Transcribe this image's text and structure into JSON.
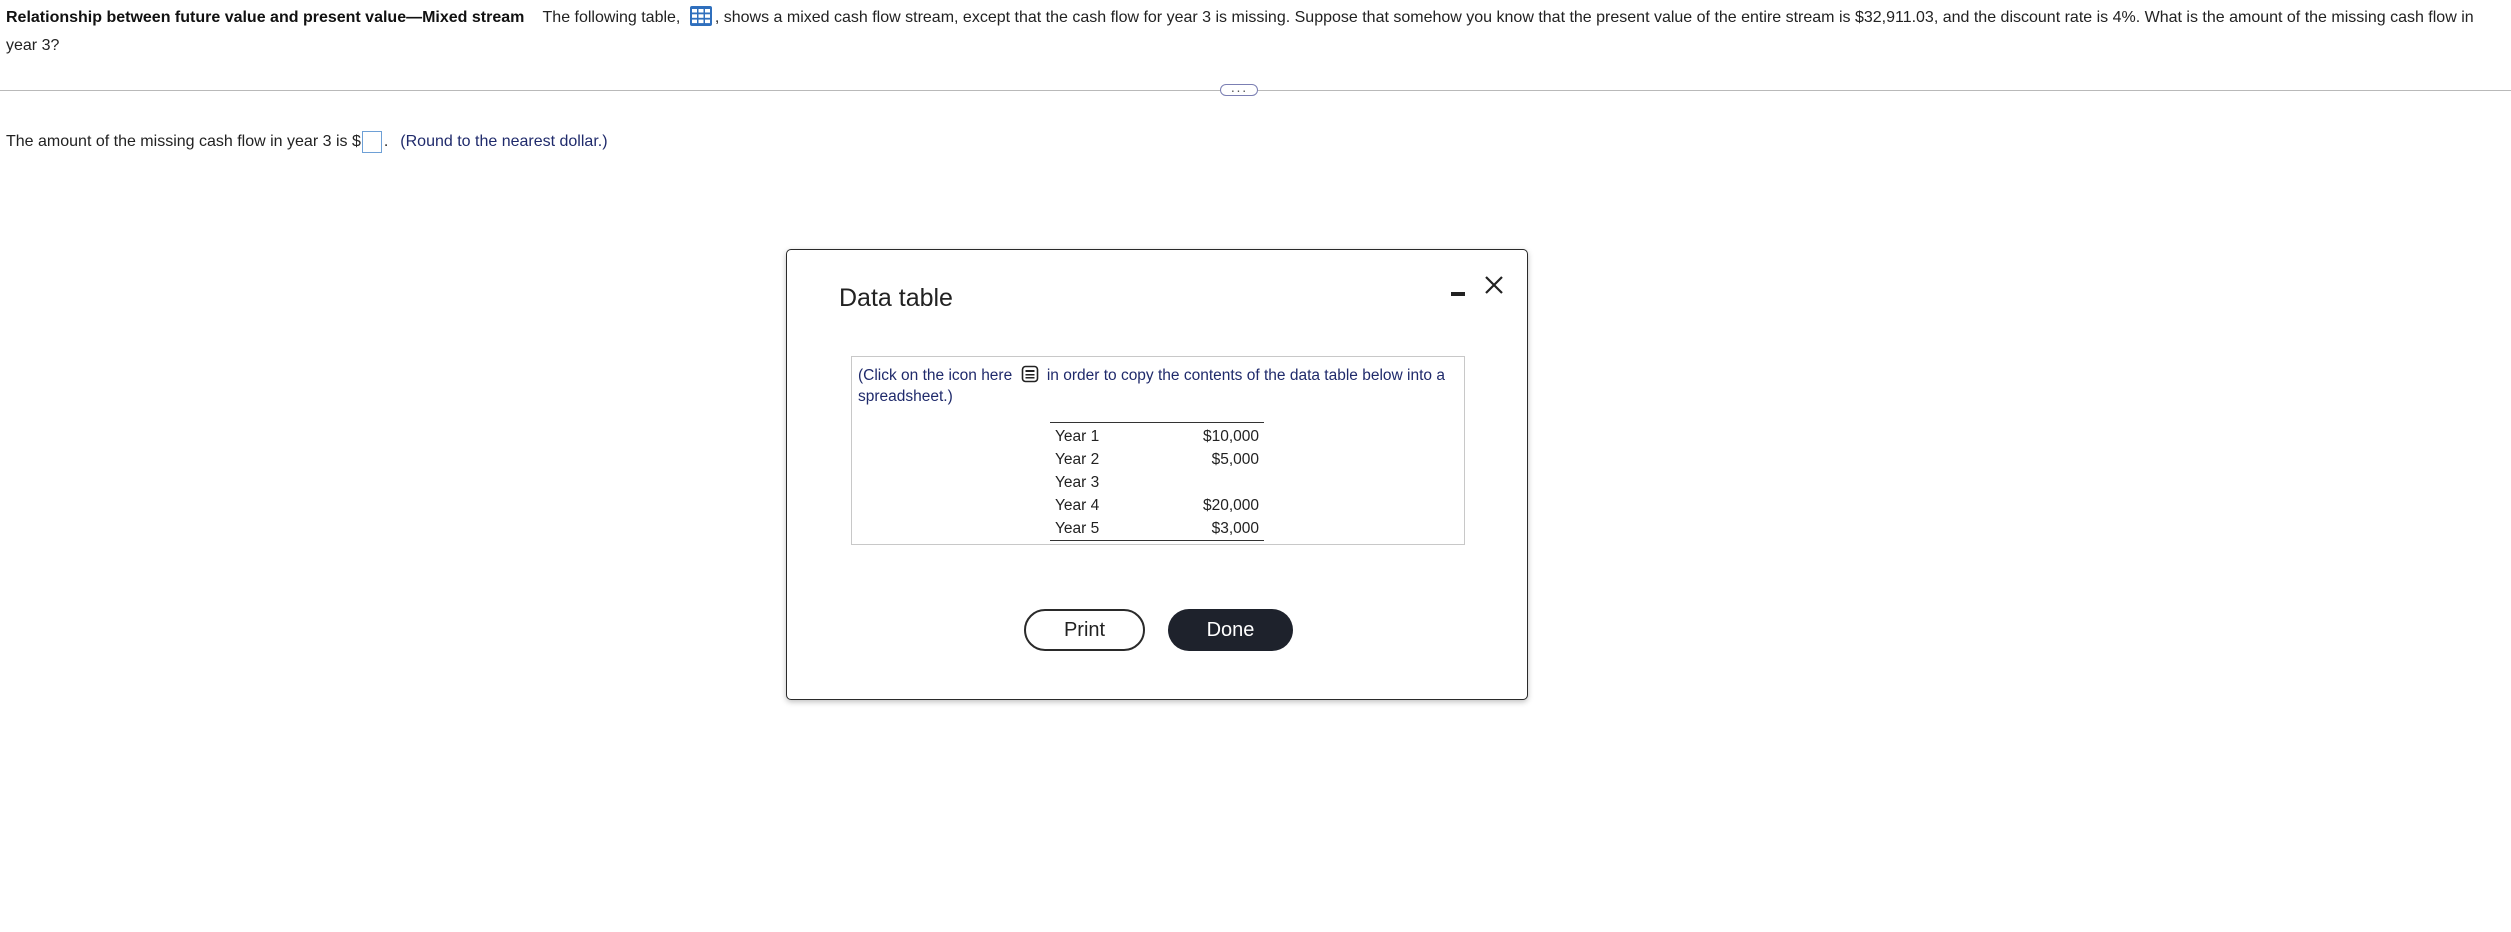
{
  "question": {
    "title": "Relationship between future value and present value—Mixed stream",
    "text_before_icon": "The following table,",
    "text_after_icon": ", shows a mixed cash flow stream, except that the cash flow for year 3 is missing.  Suppose that somehow you know that the present value of the entire stream is $32,911.03, and the discount rate is 4%.  What is the amount of the missing cash flow in year 3?",
    "table_icon": "table-grid-icon"
  },
  "more_button_label": "···",
  "answer": {
    "prefix": "The amount of the missing cash flow in year 3 is $",
    "input_value": "",
    "suffix": ".",
    "round_note": "(Round to the nearest dollar.)"
  },
  "modal": {
    "title": "Data table",
    "copy_note_before": "(Click on the icon here",
    "copy_note_after": "in order to copy the contents of the data table below into a spreadsheet.)",
    "rows": [
      {
        "label": "Year 1",
        "value": "$10,000"
      },
      {
        "label": "Year 2",
        "value": "$5,000"
      },
      {
        "label": "Year 3",
        "value": ""
      },
      {
        "label": "Year 4",
        "value": "$20,000"
      },
      {
        "label": "Year 5",
        "value": "$3,000"
      }
    ],
    "print_label": "Print",
    "done_label": "Done"
  },
  "colors": {
    "accent_blue": "#2f6fbd",
    "done_bg": "#1e222c",
    "note_text": "#1f2a6b"
  }
}
